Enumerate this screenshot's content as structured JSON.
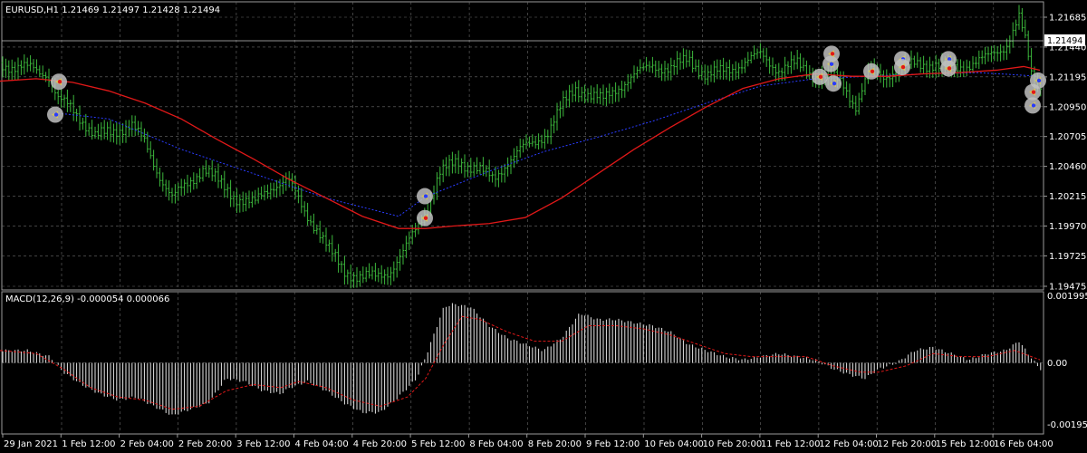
{
  "main_chart": {
    "title": "EURUSD,H1  1.21469 1.21497 1.21428 1.21494",
    "current_price_label": "1.21494",
    "price_axis_labels": [
      "1.21685",
      "1.21440",
      "1.21195",
      "1.20950",
      "1.20705",
      "1.20460",
      "1.20215",
      "1.19970",
      "1.19725",
      "1.19475"
    ]
  },
  "macd_panel": {
    "title": "MACD(12,26,9) -0.000054 0.000066",
    "axis_labels": [
      "0.001995",
      "0.00",
      "-0.00195"
    ]
  },
  "time_axis_labels": [
    "29 Jan 2021",
    "1 Feb 12:00",
    "2 Feb 04:00",
    "2 Feb 20:00",
    "3 Feb 12:00",
    "4 Feb 04:00",
    "4 Feb 20:00",
    "5 Feb 12:00",
    "8 Feb 04:00",
    "8 Feb 20:00",
    "9 Feb 12:00",
    "10 Feb 04:00",
    "10 Feb 20:00",
    "11 Feb 12:00",
    "12 Feb 04:00",
    "12 Feb 20:00",
    "15 Feb 12:00",
    "16 Feb 04:00"
  ],
  "colors": {
    "background": "#000000",
    "grid": "#6b6b6b",
    "candles": "#3cb83c",
    "ma_slow": "#e01818",
    "ma_dotted": "#2a3cff",
    "macd_hist": "#e8e8e8",
    "macd_signal": "#e01818",
    "arrow_marker_bg": "#bfbfbf"
  },
  "chart_data": [
    {
      "type": "candlestick",
      "title": "EURUSD,H1",
      "ylim": [
        1.19475,
        1.21685
      ],
      "indicators": [
        "moving-average (red)",
        "moving-average (blue dotted)",
        "buy/sell arrow markers"
      ],
      "x": [
        "29 Jan 2021",
        "1 Feb 12:00",
        "2 Feb 04:00",
        "2 Feb 20:00",
        "3 Feb 12:00",
        "4 Feb 04:00",
        "4 Feb 20:00",
        "5 Feb 12:00",
        "8 Feb 04:00",
        "8 Feb 20:00",
        "9 Feb 12:00",
        "10 Feb 04:00",
        "10 Feb 20:00",
        "11 Feb 12:00",
        "12 Feb 04:00",
        "12 Feb 20:00",
        "15 Feb 12:00",
        "16 Feb 04:00"
      ],
      "close_path": [
        [
          0,
          1.2132
        ],
        [
          18,
          1.2125
        ],
        [
          36,
          1.2128
        ],
        [
          52,
          1.2122
        ],
        [
          64,
          1.21
        ],
        [
          78,
          1.2095
        ],
        [
          90,
          1.2085
        ],
        [
          105,
          1.207
        ],
        [
          125,
          1.2075
        ],
        [
          145,
          1.208
        ],
        [
          160,
          1.2065
        ],
        [
          175,
          1.204
        ],
        [
          190,
          1.202
        ],
        [
          205,
          1.203
        ],
        [
          225,
          1.2045
        ],
        [
          245,
          1.203
        ],
        [
          262,
          1.202
        ],
        [
          280,
          1.2015
        ],
        [
          300,
          1.203
        ],
        [
          318,
          1.2035
        ],
        [
          335,
          1.201
        ],
        [
          350,
          1.1995
        ],
        [
          365,
          1.1975
        ],
        [
          380,
          1.196
        ],
        [
          398,
          1.1955
        ],
        [
          415,
          1.1955
        ],
        [
          430,
          1.196
        ],
        [
          445,
          1.1975
        ],
        [
          460,
          1.1995
        ],
        [
          470,
          1.201
        ],
        [
          485,
          1.204
        ],
        [
          505,
          1.205
        ],
        [
          525,
          1.2045
        ],
        [
          545,
          1.2035
        ],
        [
          560,
          1.205
        ],
        [
          575,
          1.206
        ],
        [
          590,
          1.2065
        ],
        [
          605,
          1.2075
        ],
        [
          620,
          1.2095
        ],
        [
          635,
          1.211
        ],
        [
          650,
          1.2105
        ],
        [
          665,
          1.21
        ],
        [
          680,
          1.211
        ],
        [
          700,
          1.212
        ],
        [
          720,
          1.213
        ],
        [
          740,
          1.2125
        ],
        [
          760,
          1.2135
        ],
        [
          780,
          1.212
        ],
        [
          800,
          1.2125
        ],
        [
          820,
          1.213
        ],
        [
          840,
          1.2138
        ],
        [
          860,
          1.2125
        ],
        [
          880,
          1.213
        ],
        [
          900,
          1.212
        ],
        [
          915,
          1.212
        ],
        [
          930,
          1.2115
        ],
        [
          945,
          1.2095
        ],
        [
          960,
          1.2125
        ],
        [
          975,
          1.212
        ],
        [
          990,
          1.2125
        ],
        [
          1010,
          1.213
        ],
        [
          1030,
          1.213
        ],
        [
          1050,
          1.2125
        ],
        [
          1070,
          1.213
        ],
        [
          1090,
          1.2135
        ],
        [
          1110,
          1.2145
        ],
        [
          1125,
          1.2168
        ],
        [
          1133,
          1.2145
        ],
        [
          1140,
          1.2115
        ],
        [
          1148,
          1.2115
        ]
      ],
      "ma_red": [
        [
          0,
          1.2116
        ],
        [
          40,
          1.2118
        ],
        [
          80,
          1.2115
        ],
        [
          120,
          1.2108
        ],
        [
          160,
          1.2098
        ],
        [
          200,
          1.2085
        ],
        [
          240,
          1.2068
        ],
        [
          280,
          1.2052
        ],
        [
          320,
          1.2035
        ],
        [
          360,
          1.202
        ],
        [
          400,
          1.2005
        ],
        [
          440,
          1.1995
        ],
        [
          470,
          1.1995
        ],
        [
          500,
          1.1997
        ],
        [
          540,
          1.1999
        ],
        [
          580,
          1.2004
        ],
        [
          620,
          1.202
        ],
        [
          660,
          1.204
        ],
        [
          700,
          1.206
        ],
        [
          740,
          1.2078
        ],
        [
          780,
          1.2095
        ],
        [
          820,
          1.211
        ],
        [
          860,
          1.2118
        ],
        [
          900,
          1.2122
        ],
        [
          940,
          1.212
        ],
        [
          980,
          1.212
        ],
        [
          1020,
          1.2122
        ],
        [
          1060,
          1.2123
        ],
        [
          1100,
          1.2125
        ],
        [
          1130,
          1.2128
        ],
        [
          1148,
          1.2125
        ]
      ],
      "ma_blue_dotted": [
        [
          60,
          1.209
        ],
        [
          120,
          1.2085
        ],
        [
          200,
          1.206
        ],
        [
          280,
          1.204
        ],
        [
          360,
          1.202
        ],
        [
          440,
          1.2005
        ],
        [
          470,
          1.2021
        ],
        [
          540,
          1.2042
        ],
        [
          600,
          1.2058
        ],
        [
          660,
          1.207
        ],
        [
          720,
          1.2083
        ],
        [
          780,
          1.2098
        ],
        [
          840,
          1.2112
        ],
        [
          900,
          1.2118
        ],
        [
          960,
          1.212
        ],
        [
          1020,
          1.2122
        ],
        [
          1080,
          1.2123
        ],
        [
          1148,
          1.212
        ]
      ],
      "markers": [
        {
          "x": 65,
          "price": 1.21155,
          "kind": "sell-arrow"
        },
        {
          "x": 61,
          "price": 1.20885,
          "kind": "buy-arrow"
        },
        {
          "x": 469,
          "price": 1.20215,
          "kind": "buy-arrow"
        },
        {
          "x": 469,
          "price": 1.20035,
          "kind": "sell-arrow"
        },
        {
          "x": 905,
          "price": 1.21195,
          "kind": "sell-arrow"
        },
        {
          "x": 917,
          "price": 1.213,
          "kind": "buy-arrow"
        },
        {
          "x": 918,
          "price": 1.21385,
          "kind": "sell-arrow"
        },
        {
          "x": 920,
          "price": 1.2114,
          "kind": "buy-arrow"
        },
        {
          "x": 962,
          "price": 1.2124,
          "kind": "sell-arrow"
        },
        {
          "x": 996,
          "price": 1.2134,
          "kind": "buy-arrow"
        },
        {
          "x": 996,
          "price": 1.21275,
          "kind": "sell-arrow"
        },
        {
          "x": 1047,
          "price": 1.2134,
          "kind": "buy-arrow"
        },
        {
          "x": 1047,
          "price": 1.21265,
          "kind": "sell-arrow"
        },
        {
          "x": 1146,
          "price": 1.21165,
          "kind": "buy-arrow"
        },
        {
          "x": 1140,
          "price": 1.2107,
          "kind": "sell-arrow"
        },
        {
          "x": 1140,
          "price": 1.2096,
          "kind": "buy-arrow"
        }
      ]
    },
    {
      "type": "bar",
      "title": "MACD(12,26,9)",
      "ylim": [
        -0.00215,
        0.00215
      ],
      "hist_path": [
        [
          0,
          0.0004
        ],
        [
          30,
          0.0004
        ],
        [
          55,
          0.0002
        ],
        [
          70,
          -0.0003
        ],
        [
          90,
          -0.0007
        ],
        [
          110,
          -0.001
        ],
        [
          130,
          -0.0012
        ],
        [
          150,
          -0.0011
        ],
        [
          170,
          -0.0014
        ],
        [
          190,
          -0.0017
        ],
        [
          210,
          -0.0015
        ],
        [
          230,
          -0.0013
        ],
        [
          250,
          -0.0005
        ],
        [
          270,
          -0.0006
        ],
        [
          290,
          -0.0009
        ],
        [
          310,
          -0.001
        ],
        [
          320,
          -0.0008
        ],
        [
          340,
          -0.0006
        ],
        [
          360,
          -0.0009
        ],
        [
          380,
          -0.0013
        ],
        [
          400,
          -0.0016
        ],
        [
          420,
          -0.0016
        ],
        [
          440,
          -0.0011
        ],
        [
          460,
          -0.0005
        ],
        [
          470,
          0.0002
        ],
        [
          480,
          0.001
        ],
        [
          490,
          0.0018
        ],
        [
          500,
          0.0019
        ],
        [
          520,
          0.0018
        ],
        [
          540,
          0.0012
        ],
        [
          560,
          0.0008
        ],
        [
          580,
          0.0006
        ],
        [
          600,
          0.0004
        ],
        [
          620,
          0.0008
        ],
        [
          640,
          0.0016
        ],
        [
          660,
          0.0014
        ],
        [
          680,
          0.0014
        ],
        [
          700,
          0.0013
        ],
        [
          720,
          0.0012
        ],
        [
          740,
          0.001
        ],
        [
          760,
          0.0006
        ],
        [
          780,
          0.0004
        ],
        [
          800,
          0.0002
        ],
        [
          820,
          0.0001
        ],
        [
          840,
          0.0002
        ],
        [
          860,
          0.0003
        ],
        [
          880,
          0.0002
        ],
        [
          900,
          0.0001
        ],
        [
          920,
          -0.0002
        ],
        [
          940,
          -0.0004
        ],
        [
          955,
          -0.0005
        ],
        [
          970,
          -0.0002
        ],
        [
          990,
          0.0
        ],
        [
          1010,
          0.0004
        ],
        [
          1030,
          0.0005
        ],
        [
          1050,
          0.0003
        ],
        [
          1070,
          0.0001
        ],
        [
          1090,
          0.0003
        ],
        [
          1110,
          0.0004
        ],
        [
          1125,
          0.0007
        ],
        [
          1135,
          0.0003
        ],
        [
          1148,
          -0.0002
        ]
      ],
      "signal_path": [
        [
          0,
          0.0004
        ],
        [
          40,
          0.0003
        ],
        [
          70,
          -0.0002
        ],
        [
          100,
          -0.0008
        ],
        [
          130,
          -0.0011
        ],
        [
          160,
          -0.0012
        ],
        [
          190,
          -0.0015
        ],
        [
          220,
          -0.0014
        ],
        [
          250,
          -0.0009
        ],
        [
          280,
          -0.0007
        ],
        [
          310,
          -0.0008
        ],
        [
          330,
          -0.0006
        ],
        [
          360,
          -0.0008
        ],
        [
          390,
          -0.0012
        ],
        [
          420,
          -0.0014
        ],
        [
          450,
          -0.0011
        ],
        [
          470,
          -0.0005
        ],
        [
          490,
          0.0006
        ],
        [
          510,
          0.0015
        ],
        [
          530,
          0.0014
        ],
        [
          560,
          0.001
        ],
        [
          590,
          0.0007
        ],
        [
          620,
          0.0007
        ],
        [
          650,
          0.0012
        ],
        [
          680,
          0.0012
        ],
        [
          710,
          0.0011
        ],
        [
          740,
          0.0009
        ],
        [
          770,
          0.0006
        ],
        [
          800,
          0.0003
        ],
        [
          830,
          0.0002
        ],
        [
          860,
          0.0002
        ],
        [
          890,
          0.0002
        ],
        [
          920,
          -0.0001
        ],
        [
          950,
          -0.0003
        ],
        [
          970,
          -0.0003
        ],
        [
          1000,
          -0.0001
        ],
        [
          1030,
          0.0003
        ],
        [
          1060,
          0.0002
        ],
        [
          1090,
          0.0002
        ],
        [
          1120,
          0.0004
        ],
        [
          1148,
          0.0001
        ]
      ]
    }
  ]
}
